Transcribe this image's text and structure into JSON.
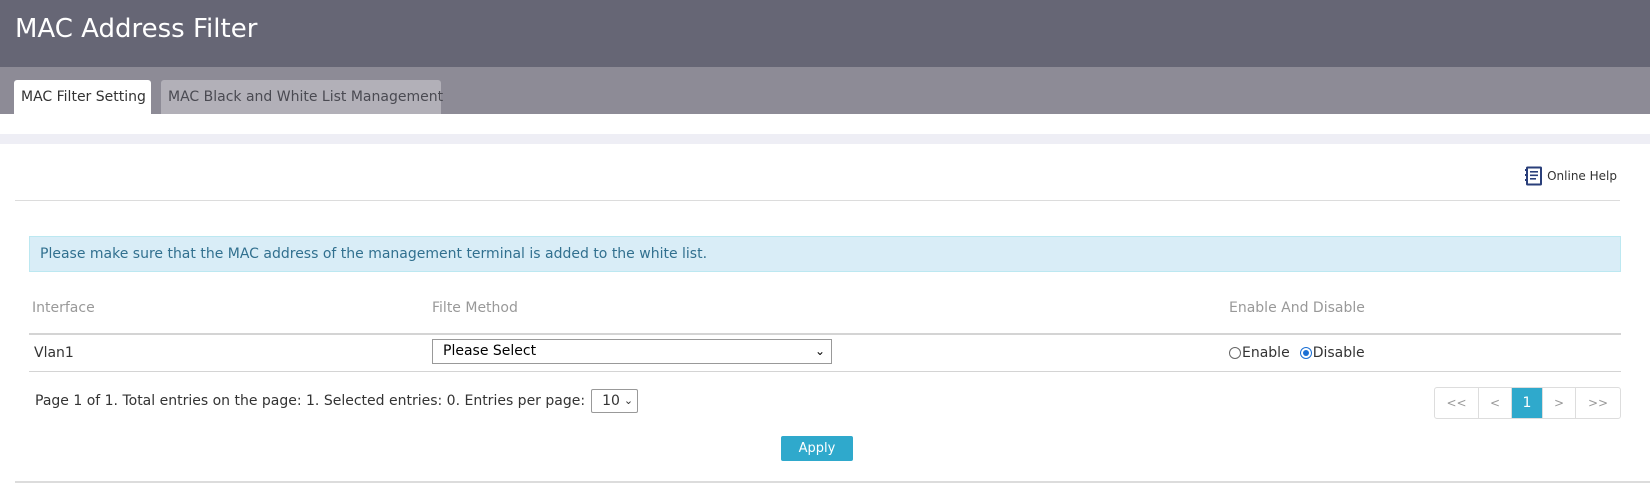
{
  "header": {
    "title": "MAC Address Filter"
  },
  "tabs": [
    {
      "label": "MAC Filter Setting",
      "active": true
    },
    {
      "label": "MAC Black and White List Management",
      "active": false
    }
  ],
  "help": {
    "label": "Online Help",
    "icon": "help-book-icon"
  },
  "notice": {
    "text": "Please make sure that the MAC address of the management terminal is added to the white list."
  },
  "table": {
    "columns": [
      "Interface",
      "Filte Method",
      "Enable And Disable"
    ],
    "rows": [
      {
        "interface": "Vlan1",
        "filter_method": "Please Select",
        "enable_label": "Enable",
        "disable_label": "Disable",
        "selected": "Disable"
      }
    ]
  },
  "pagination": {
    "info": "Page 1 of 1. Total entries on the page: 1. Selected entries: 0. Entries per page:",
    "per_page": "10",
    "buttons": [
      "<<",
      "<",
      "1",
      ">",
      ">>"
    ],
    "current": "1"
  },
  "actions": {
    "apply_label": "Apply"
  },
  "colors": {
    "header_bg": "#666675",
    "tabbar_bg": "#8d8b96",
    "accent": "#2fa9cc",
    "notice_bg": "#d9edf7",
    "notice_text": "#31708f"
  }
}
